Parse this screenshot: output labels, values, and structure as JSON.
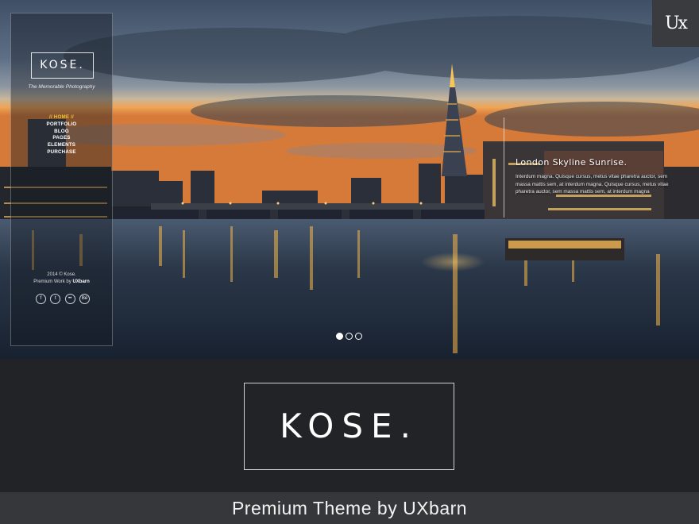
{
  "badge": {
    "label": "Ux"
  },
  "sidebar": {
    "logo": "KOSE.",
    "tagline": "The Memorable Photography",
    "nav": [
      {
        "label": "// HOME //",
        "active": true
      },
      {
        "label": "PORTFOLIO"
      },
      {
        "label": "BLOG"
      },
      {
        "label": "PAGES"
      },
      {
        "label": "ELEMENTS"
      },
      {
        "label": "PURCHASE"
      }
    ],
    "copyright": "2014 © Kose.",
    "credit_prefix": "Premium Work by",
    "credit_brand": "UXbarn",
    "social": [
      {
        "icon": "facebook-icon",
        "glyph": "f"
      },
      {
        "icon": "twitter-icon",
        "glyph": "t"
      },
      {
        "icon": "flickr-icon",
        "glyph": "••"
      },
      {
        "icon": "behance-icon",
        "glyph": "Bē"
      }
    ]
  },
  "slide": {
    "title": "London Skyline Sunrise.",
    "body": "Interdum magna. Quisque cursus, metus vitae pharetra auctor, sem massa mattis sem, at interdum magna. Quisque cursus, metus vitae pharetra auctor, sem massa mattis sem, at interdum magna"
  },
  "pager": {
    "count": 3,
    "active_index": 0
  },
  "theme_logo": "KOSE.",
  "footer": "Premium Theme by UXbarn",
  "colors": {
    "band": "#222326",
    "footer": "#36373a",
    "nav_active": "#f1c232"
  }
}
